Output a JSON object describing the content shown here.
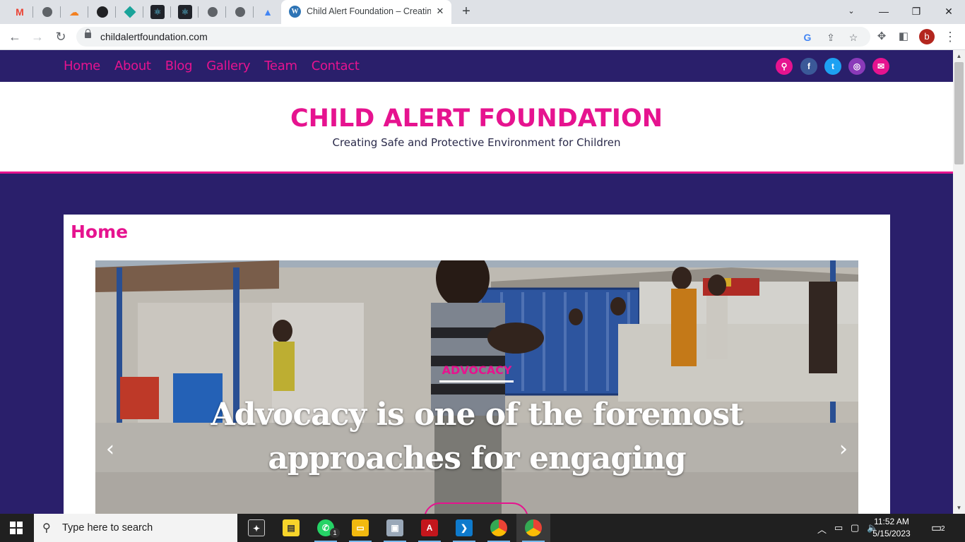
{
  "browser": {
    "active_tab_title": "Child Alert Foundation – Creating",
    "url": "childalertfoundation.com",
    "pinned_tabs": [
      "gmail-icon",
      "globe-icon",
      "cloudflare-icon",
      "github-icon",
      "diamond-app-icon",
      "react-icon",
      "react-icon",
      "globe-icon",
      "globe-icon",
      "graduation-cap-icon"
    ],
    "profile_initial": "b"
  },
  "site": {
    "nav": [
      "Home",
      "About",
      "Blog",
      "Gallery",
      "Team",
      "Contact"
    ],
    "title": "CHILD ALERT FOUNDATION",
    "tagline": "Creating Safe and Protective Environment for Children",
    "page_title": "Home",
    "slide": {
      "category": "ADVOCACY",
      "headline": "Advocacy is one of the foremost approaches for engaging"
    },
    "colors": {
      "brand_pink": "#e6138f",
      "brand_navy": "#2a1f6b"
    }
  },
  "taskbar": {
    "search_placeholder": "Type here to search",
    "time": "11:52 AM",
    "date": "5/15/2023",
    "notification_count": "2",
    "whatsapp_badge": "1"
  }
}
